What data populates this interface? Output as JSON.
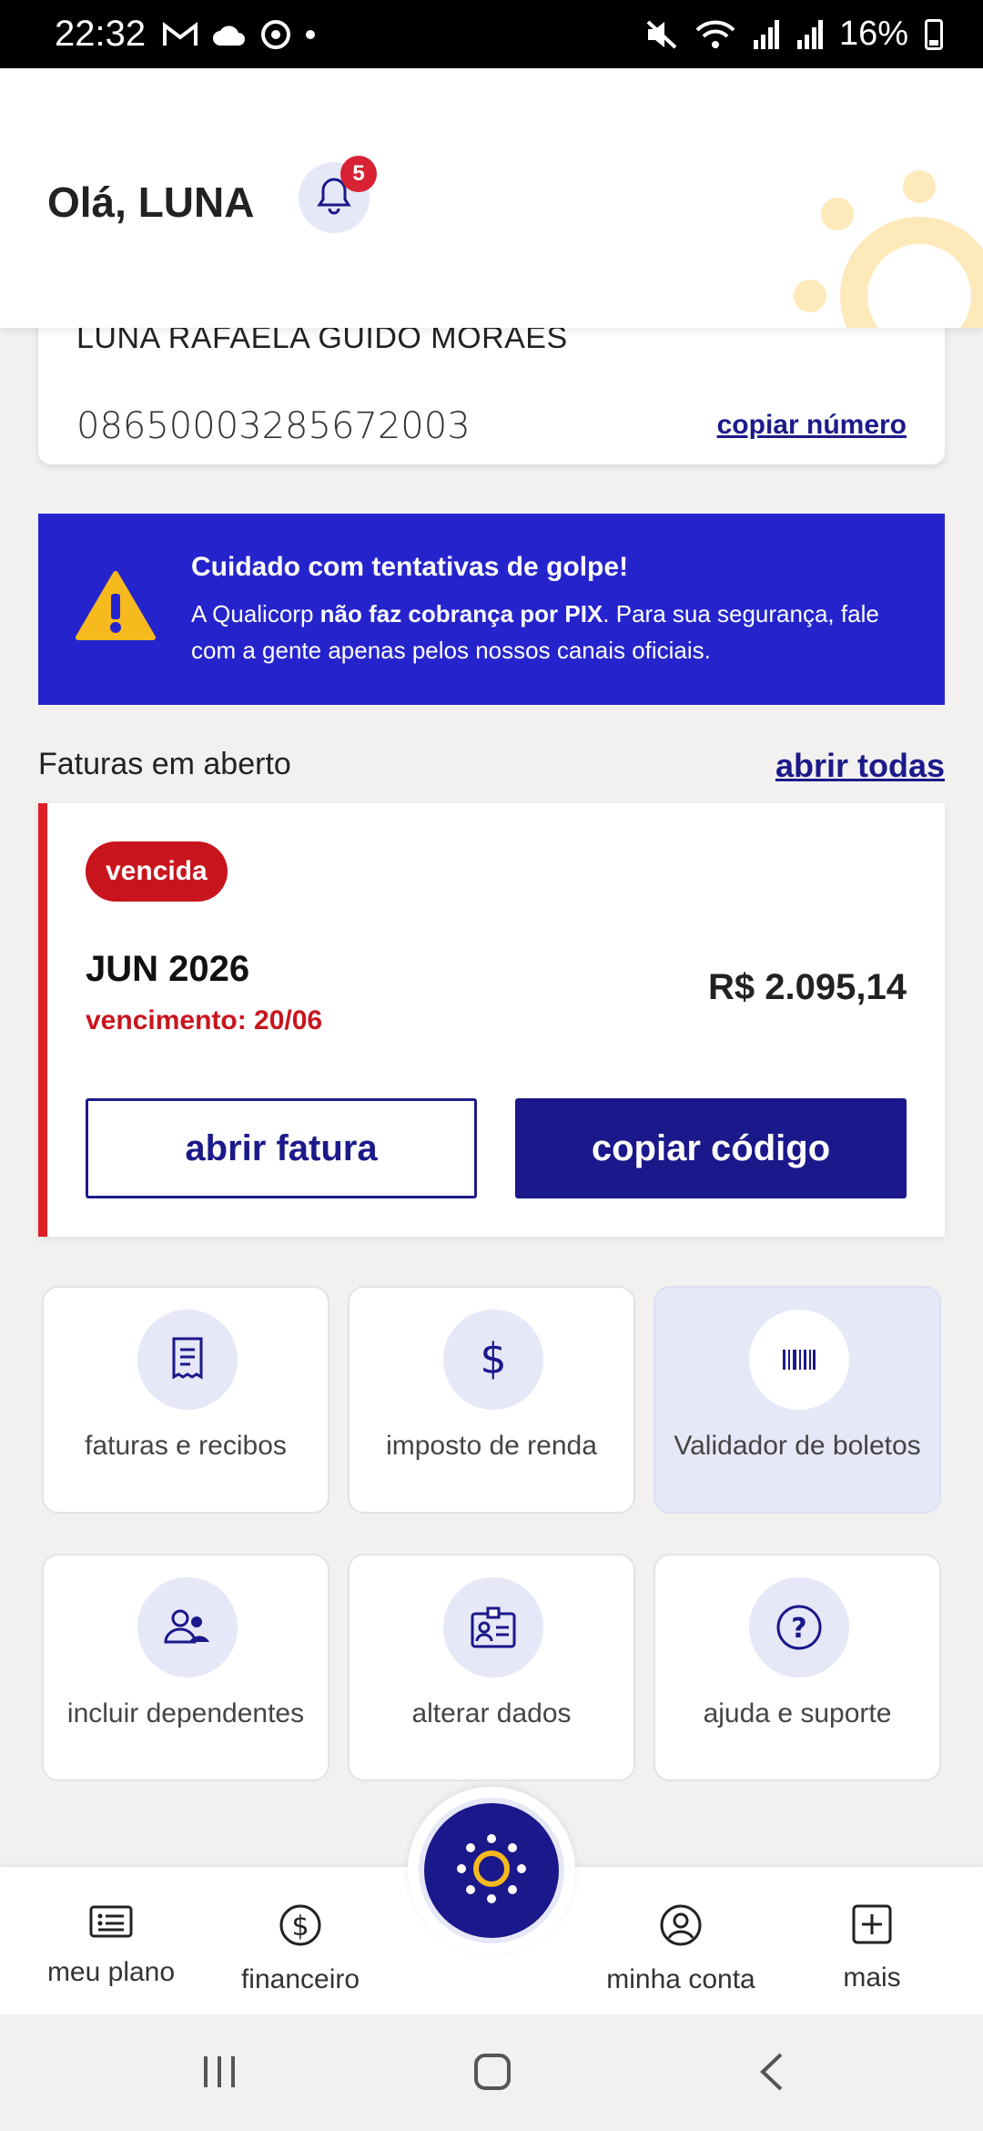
{
  "status_bar": {
    "time": "22:32",
    "battery": "16%",
    "icons": [
      "gmail-icon",
      "cloud-icon",
      "chrome-icon",
      "dot-icon",
      "mute-icon",
      "wifi-icon",
      "signal-icon",
      "signal-icon",
      "battery-icon"
    ]
  },
  "header": {
    "greeting": "Olá, LUNA",
    "notifications_count": "5"
  },
  "plan_card": {
    "name": "LUNA RAFAELA GUIDO MORAES",
    "number": "08650003285672003",
    "copy_label": "copiar número"
  },
  "warning": {
    "title": "Cuidado com tentativas de golpe!",
    "text_prefix": "A Qualicorp ",
    "text_bold": "não faz cobrança por PIX",
    "text_suffix": ". Para sua segurança, fale com a gente apenas pelos nossos canais oficiais.",
    "color": "#2524cc"
  },
  "invoices": {
    "section_title": "Faturas em aberto",
    "open_all": "abrir todas",
    "items": [
      {
        "status": "vencida",
        "month": "JUN 2026",
        "due": "vencimento: 20/06",
        "amount": "R$ 2.095,14",
        "open_button": "abrir fatura",
        "copy_button": "copiar código"
      }
    ]
  },
  "tiles": [
    {
      "label": "faturas e recibos",
      "icon": "receipt-icon"
    },
    {
      "label": "imposto de renda",
      "icon": "dollar-icon"
    },
    {
      "label": "Validador de boletos",
      "icon": "barcode-icon"
    },
    {
      "label": "incluir dependentes",
      "icon": "users-icon"
    },
    {
      "label": "alterar dados",
      "icon": "id-card-icon"
    },
    {
      "label": "ajuda e suporte",
      "icon": "help-icon"
    }
  ],
  "bottom_nav": {
    "items": [
      {
        "label": "meu plano",
        "icon": "list-card-icon"
      },
      {
        "label": "financeiro",
        "icon": "dollar-circle-icon"
      },
      {
        "label": "minha conta",
        "icon": "user-circle-icon"
      },
      {
        "label": "mais",
        "icon": "plus-square-icon"
      }
    ],
    "center_icon": "sun-icon"
  },
  "colors": {
    "primary": "#1a188a",
    "alert": "#c8151d",
    "accent": "#f6b91e",
    "tile_bg": "#e6e7f7"
  }
}
